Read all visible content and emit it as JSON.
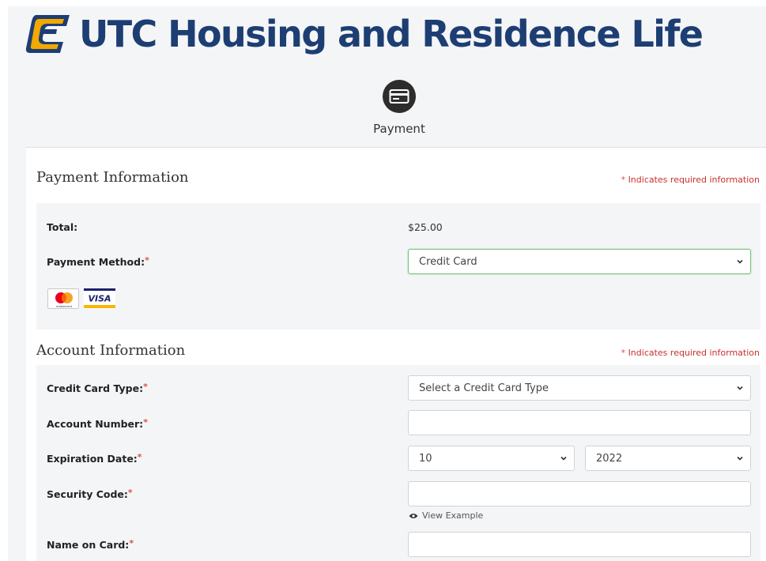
{
  "header": {
    "brand_title": "UTC Housing and Residence Life",
    "step_label": "Payment",
    "step_icon": "credit-card-icon"
  },
  "colors": {
    "brand_blue": "#1d3e73",
    "brand_gold": "#f2a900",
    "required_red": "#c9302c",
    "active_border": "#7cc07f"
  },
  "payment": {
    "title": "Payment Information",
    "required_note": "Indicates required information",
    "required_mark": "*",
    "total_label": "Total:",
    "total_value": "$25.00",
    "method_label": "Payment Method:",
    "method_value": "Credit Card",
    "card_logos": [
      "mastercard",
      "VISA"
    ]
  },
  "account": {
    "title": "Account Information",
    "required_note": "Indicates required information",
    "card_type_label": "Credit Card Type:",
    "card_type_placeholder": "Select a Credit Card Type",
    "account_number_label": "Account Number:",
    "expiration_label": "Expiration Date:",
    "exp_month": "10",
    "exp_year": "2022",
    "security_code_label": "Security Code:",
    "view_example": "View Example",
    "name_label": "Name on Card:"
  }
}
